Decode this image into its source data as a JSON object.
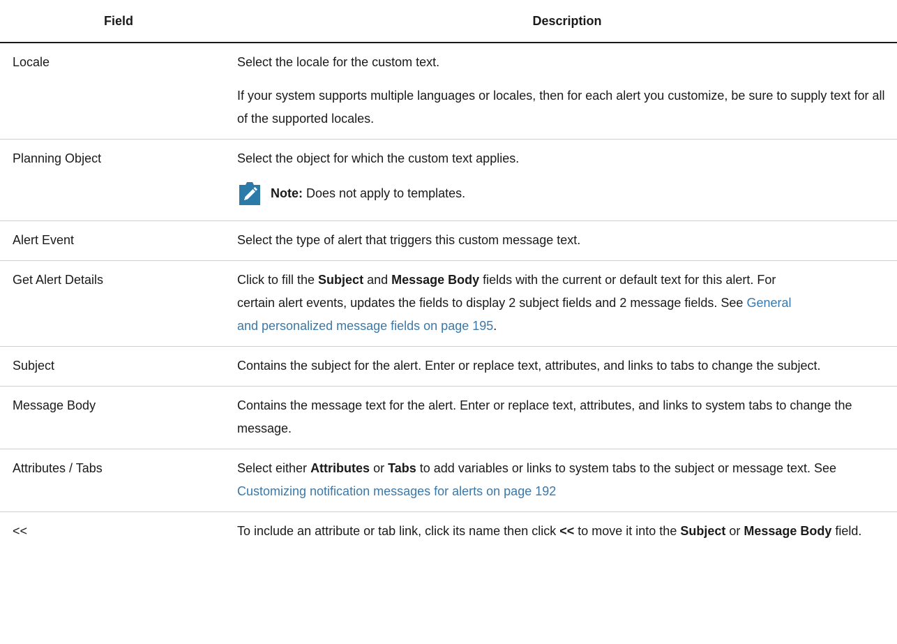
{
  "header": {
    "field": "Field",
    "description": "Description"
  },
  "rows": [
    {
      "field": "Locale",
      "desc": "Select the locale for the custom text.",
      "desc2": "If your system supports multiple languages or locales, then for each alert you customize, be sure to supply text for all of the supported locales."
    },
    {
      "field": "Planning Object",
      "desc": "Select the object for which the custom text applies.",
      "note_label": "Note:",
      "note_text": " Does not apply to templates."
    },
    {
      "field": "Alert Event",
      "desc": "Select the type of alert that triggers this custom message text."
    },
    {
      "field": "Get Alert Details",
      "d1": "Click to fill the ",
      "b1": "Subject",
      "d2": " and ",
      "b2": "Message Body",
      "d3": " fields with the current or default text for this alert. For certain alert events, updates the fields to display 2 subject fields and 2 message fields. See ",
      "link": "General and personalized message fields on page 195",
      "d4": "."
    },
    {
      "field": "Subject",
      "desc": "Contains the subject for the alert. Enter or replace text, attributes, and links to tabs to change the subject."
    },
    {
      "field": "Message Body",
      "desc": "Contains the message text for the alert. Enter or replace text, attributes, and links to system tabs to change the message."
    },
    {
      "field": "Attributes / Tabs",
      "d1": "Select either ",
      "b1": "Attributes",
      "d2": " or ",
      "b2": "Tabs",
      "d3": " to add variables or links to system tabs to the subject or message text. See ",
      "link": "Customizing notification messages for alerts on page 192"
    },
    {
      "field": "<<",
      "d1": "To include an attribute or tab link, click its name then click ",
      "b1": "<<",
      "d2": " to move it into the ",
      "b2": "Subject",
      "d3": " or ",
      "b3": "Message Body",
      "d4": " field."
    }
  ],
  "colors": {
    "link": "#3b78a8",
    "note_icon": "#2b7aa8"
  },
  "icons": {
    "note": "pencil-clipboard-icon"
  }
}
